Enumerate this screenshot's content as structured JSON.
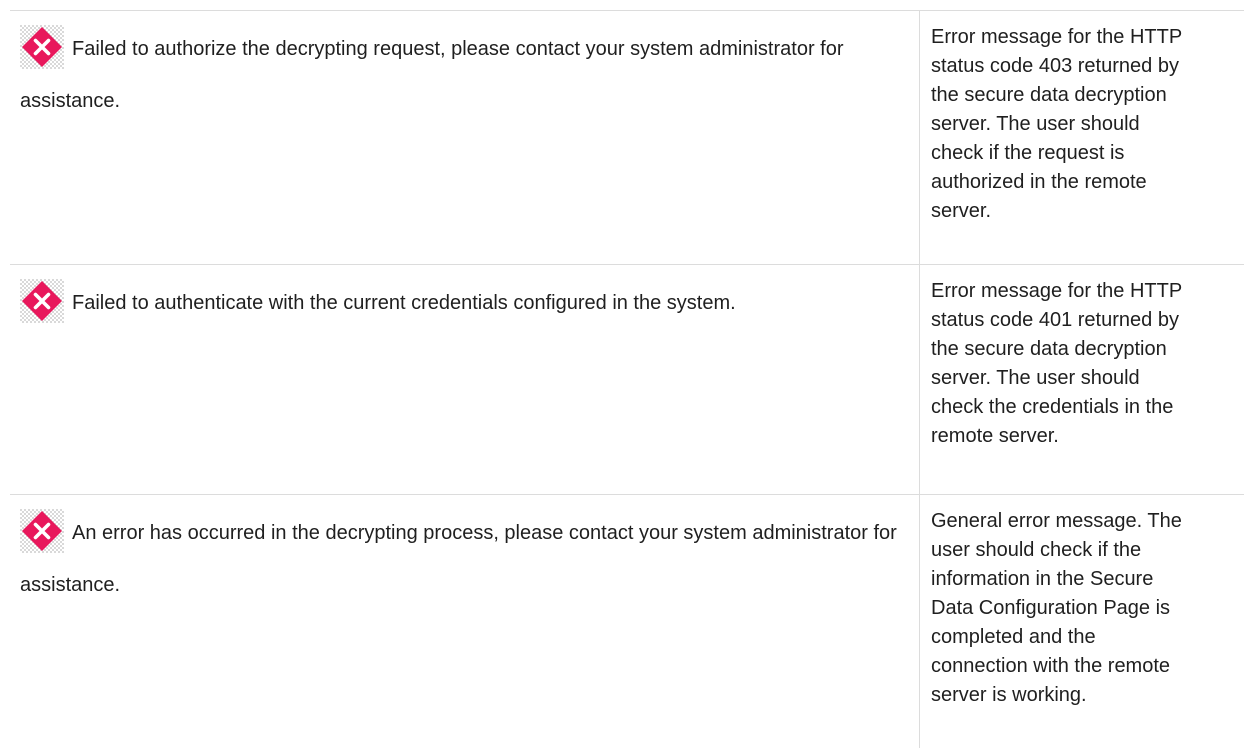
{
  "rows": [
    {
      "icon": "error-icon",
      "message": "Failed to authorize the decrypting request, please contact your system administrator for assistance.",
      "description": "Error message for the HTTP\nstatus code 403 returned by\nthe secure data decryption\nserver. The user should\ncheck if the request is\nauthorized in the remote\nserver."
    },
    {
      "icon": "error-icon",
      "message": "Failed to authenticate with the current credentials configured in the system.",
      "description": "Error message for the HTTP\nstatus code 401 returned by\nthe secure data decryption\nserver. The user should\ncheck the credentials in the\nremote server."
    },
    {
      "icon": "error-icon",
      "message": "An error has occurred in the decrypting process, please contact your system administrator for assistance.",
      "description": "General error message. The\nuser should check if the\ninformation in the Secure\nData Configuration Page is\ncompleted and the\nconnection with the remote\nserver is working."
    }
  ],
  "colors": {
    "error_icon_fill": "#e8185c",
    "error_icon_glyph": "#ffffff",
    "border": "#dcdcdc",
    "text": "#1f1f1f"
  }
}
